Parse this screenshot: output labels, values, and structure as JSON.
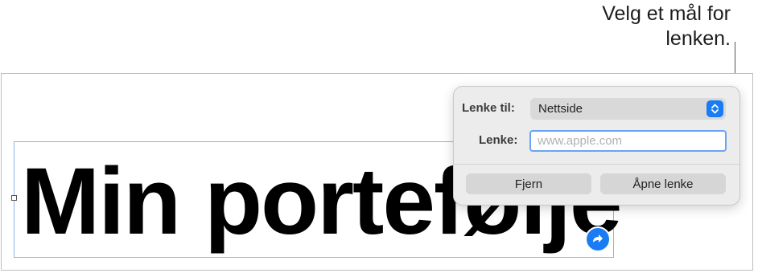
{
  "callout": {
    "line1": "Velg et mål for",
    "line2": "lenken."
  },
  "document": {
    "title": "Min portefølje"
  },
  "popover": {
    "link_to_label": "Lenke til:",
    "link_to_value": "Nettside",
    "link_label": "Lenke:",
    "link_placeholder": "www.apple.com",
    "link_value": "",
    "remove_button": "Fjern",
    "open_button": "Åpne lenke"
  },
  "colors": {
    "accent": "#1a7cf5",
    "selection": "#8fb2e8"
  },
  "icons": {
    "link_badge": "link-arrow-icon",
    "select_arrows": "chevron-up-down-icon"
  }
}
